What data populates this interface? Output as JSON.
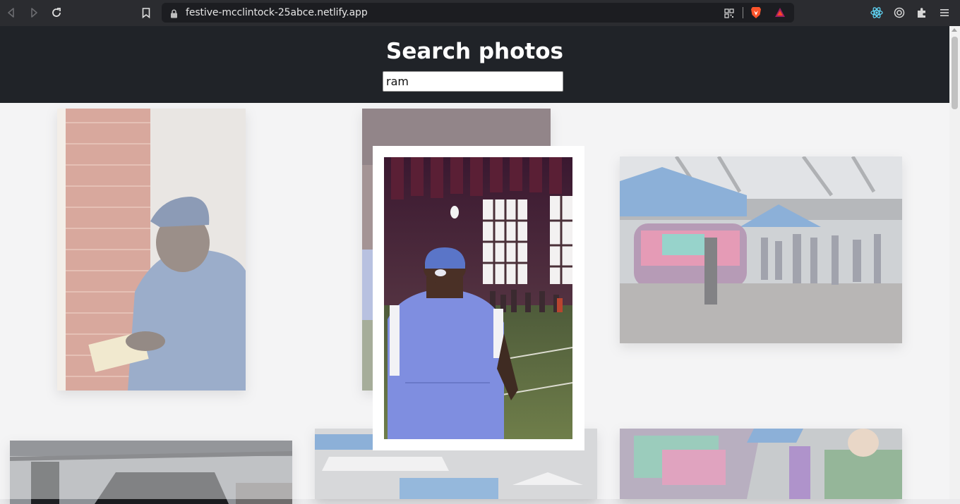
{
  "browser": {
    "url": "festive-mcclintock-25abce.netlify.app",
    "icons": [
      "back-icon",
      "forward-icon",
      "reload-icon",
      "bookmark-icon",
      "lock-icon",
      "qr-code-icon",
      "brave-shields-icon",
      "brave-rewards-icon",
      "react-devtools-icon",
      "wallet-icon",
      "extensions-icon",
      "menu-icon"
    ]
  },
  "header": {
    "title": "Search photos",
    "search_value": "ram"
  },
  "colors": {
    "header_bg": "#202328",
    "page_bg": "#ebebed",
    "modal_bg": "#ffffff"
  }
}
